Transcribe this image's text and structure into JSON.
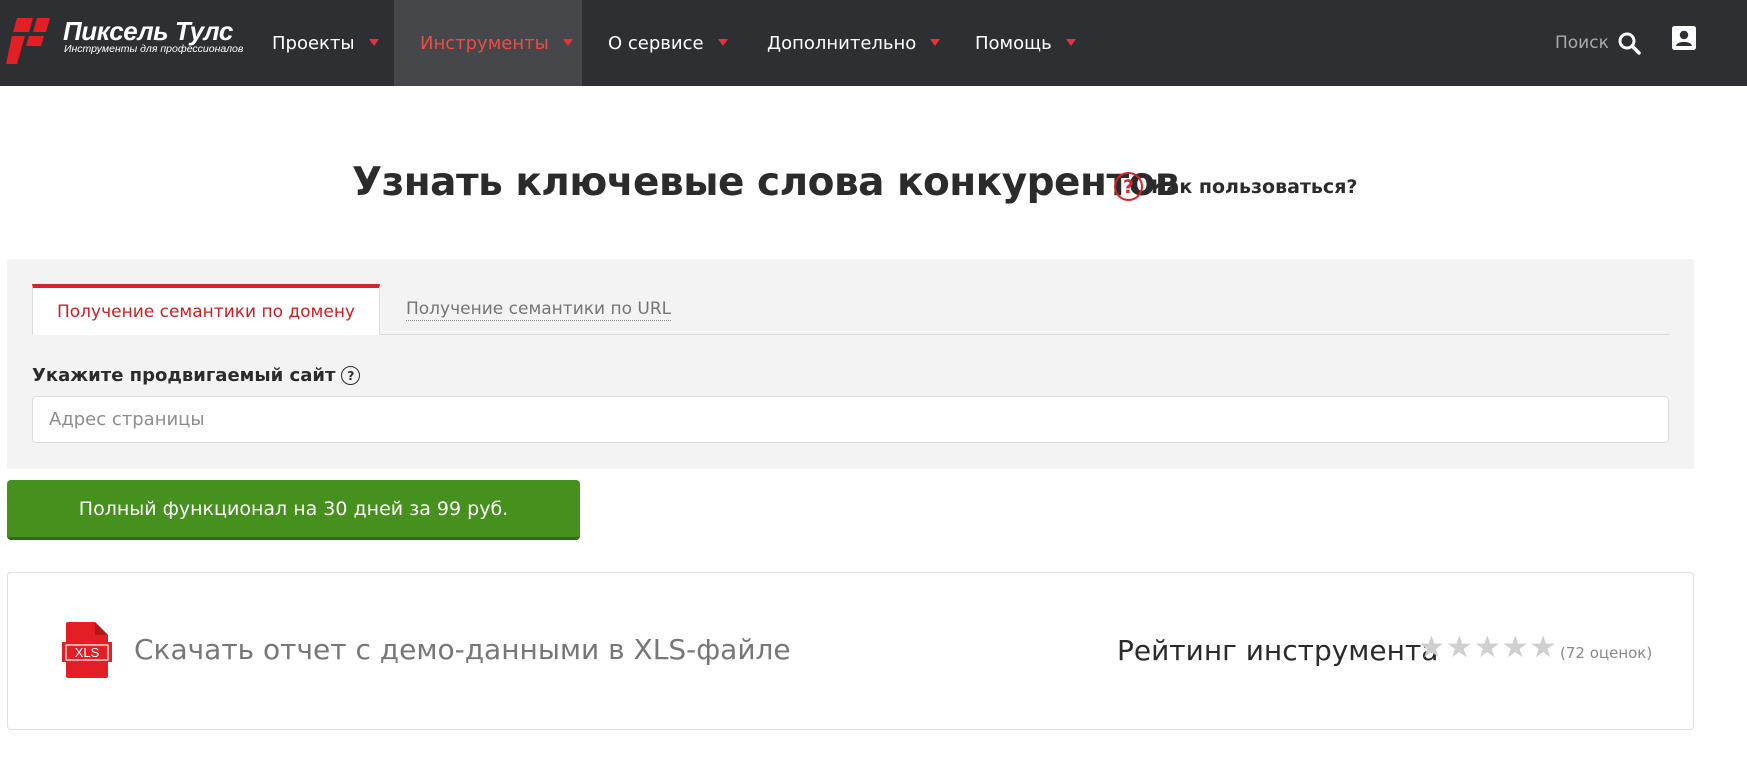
{
  "header": {
    "logo_title": "Пиксель Тулс",
    "logo_subtitle": "Инструменты для профессионалов",
    "nav": [
      {
        "label": "Проекты"
      },
      {
        "label": "Инструменты"
      },
      {
        "label": "О сервисе"
      },
      {
        "label": "Дополнительно"
      },
      {
        "label": "Помощь"
      }
    ],
    "search_label": "Поиск"
  },
  "page": {
    "title": "Узнать ключевые слова конкурентов",
    "howto_label": "Как пользоваться?"
  },
  "tabs": [
    {
      "label": "Получение семантики по домену",
      "active": true
    },
    {
      "label": "Получение семантики по URL",
      "active": false
    }
  ],
  "form": {
    "site_label": "Укажите продвигаемый сайт",
    "address_placeholder": "Адрес страницы",
    "address_value": ""
  },
  "promo": {
    "button_label": "Полный функционал на 30 дней за 99 руб."
  },
  "report": {
    "icon_text": "XLS",
    "download_label": "Скачать отчет с демо-данными в XLS-файле",
    "rating_label": "Рейтинг инструмента",
    "rating_count": "(72 оценок)",
    "stars_total": 5,
    "stars_filled": 0
  },
  "colors": {
    "accent_red": "#d9232b",
    "topbar_bg": "#2d2f33",
    "green_button": "#46911d"
  }
}
